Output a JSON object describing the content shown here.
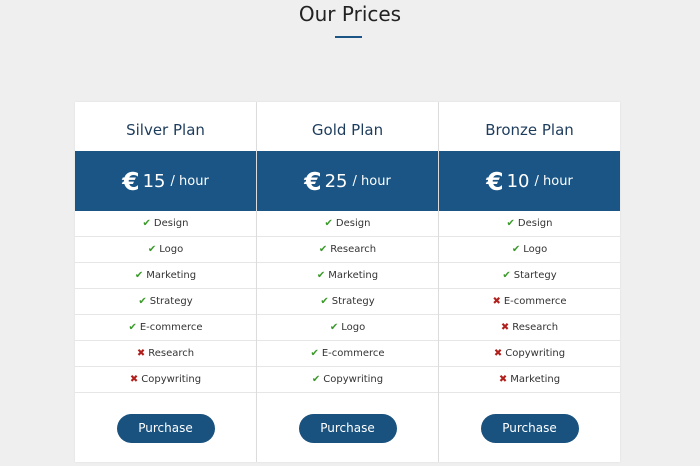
{
  "heading": "Our Prices",
  "colors": {
    "accent": "#1a5585",
    "check": "#3a9a2a",
    "cross": "#b0201c"
  },
  "plans": [
    {
      "name": "Silver Plan",
      "currency": "€",
      "amount": "15",
      "unit": "/ hour",
      "features": [
        {
          "label": "Design",
          "included": true
        },
        {
          "label": "Logo",
          "included": true
        },
        {
          "label": "Marketing",
          "included": true
        },
        {
          "label": "Strategy",
          "included": true
        },
        {
          "label": "E-commerce",
          "included": true
        },
        {
          "label": "Research",
          "included": false
        },
        {
          "label": "Copywriting",
          "included": false
        }
      ],
      "button": "Purchase"
    },
    {
      "name": "Gold Plan",
      "currency": "€",
      "amount": "25",
      "unit": "/ hour",
      "features": [
        {
          "label": "Design",
          "included": true
        },
        {
          "label": "Research",
          "included": true
        },
        {
          "label": "Marketing",
          "included": true
        },
        {
          "label": "Strategy",
          "included": true
        },
        {
          "label": "Logo",
          "included": true
        },
        {
          "label": "E-commerce",
          "included": true
        },
        {
          "label": "Copywriting",
          "included": true
        }
      ],
      "button": "Purchase"
    },
    {
      "name": "Bronze Plan",
      "currency": "€",
      "amount": "10",
      "unit": "/ hour",
      "features": [
        {
          "label": "Design",
          "included": true
        },
        {
          "label": "Logo",
          "included": true
        },
        {
          "label": "Startegy",
          "included": true
        },
        {
          "label": "E-commerce",
          "included": false
        },
        {
          "label": "Research",
          "included": false
        },
        {
          "label": "Copywriting",
          "included": false
        },
        {
          "label": "Marketing",
          "included": false
        }
      ],
      "button": "Purchase"
    }
  ]
}
